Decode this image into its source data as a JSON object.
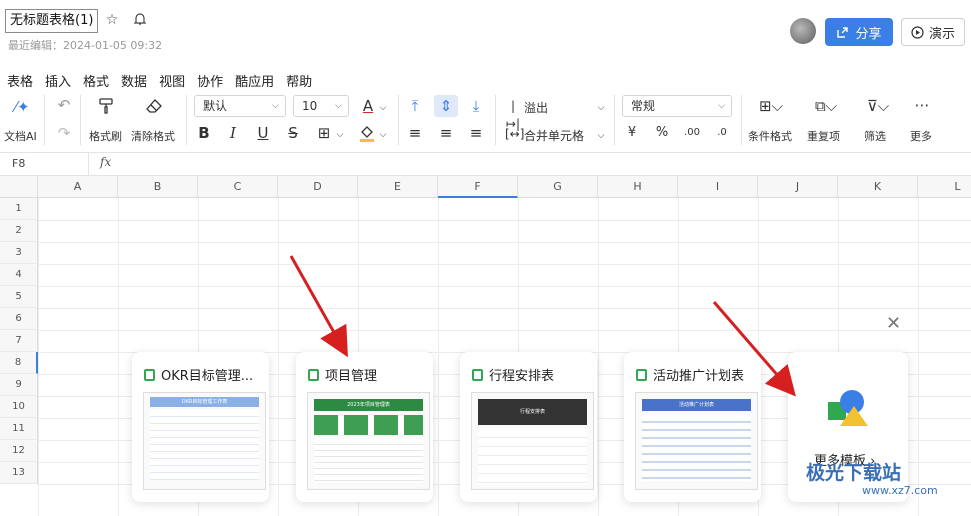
{
  "header": {
    "doc_title": "无标题表格(1)",
    "last_edit": "最近编辑：2024-01-05 09:32",
    "share_label": "分享",
    "present_label": "演示"
  },
  "menu": [
    "表格",
    "插入",
    "格式",
    "数据",
    "视图",
    "协作",
    "酷应用",
    "帮助"
  ],
  "toolbar": {
    "doc_ai": "文档AI",
    "format_painter": "格式刷",
    "clear_format": "清除格式",
    "font": "默认",
    "font_size": "10",
    "overflow": "溢出",
    "merge": "合并单元格",
    "number_format": "常规",
    "cond_format": "条件格式",
    "duplicates": "重复项",
    "filter": "筛选",
    "more": "更多"
  },
  "formula_bar": {
    "cell_ref": "F8",
    "fx": "fx"
  },
  "columns": [
    "A",
    "B",
    "C",
    "D",
    "E",
    "F",
    "G",
    "H",
    "I",
    "J",
    "K",
    "L"
  ],
  "rows": [
    "1",
    "2",
    "3",
    "4",
    "5",
    "6",
    "7",
    "8",
    "9",
    "10",
    "11",
    "12",
    "13"
  ],
  "templates": [
    {
      "title": "OKR目标管理...",
      "thumb_title": "OKR目标管理工作表"
    },
    {
      "title": "项目管理",
      "thumb_title": "2023年项目管理表"
    },
    {
      "title": "行程安排表",
      "thumb_title": "行程安排表"
    },
    {
      "title": "活动推广计划表",
      "thumb_title": "活动推广计划表"
    }
  ],
  "more_templates": "更多模板 ›",
  "watermark": {
    "logo_text": "极光下载站",
    "url": "www.xz7.com"
  },
  "colors": {
    "accent": "#3a7fe6",
    "green": "#2fa84f",
    "arrow": "#d62020"
  }
}
